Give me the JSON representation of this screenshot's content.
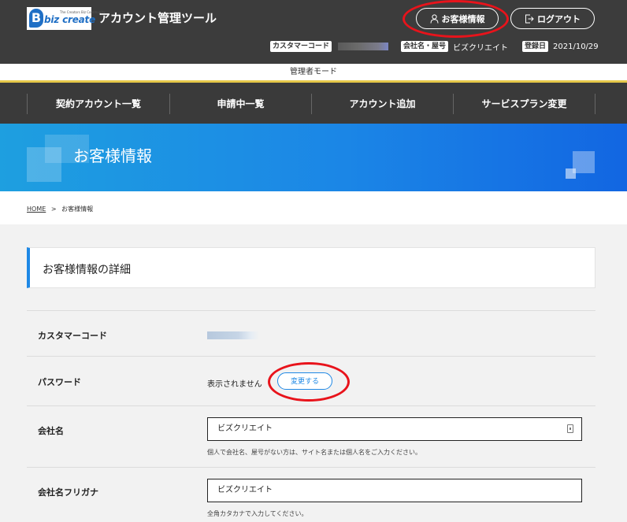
{
  "header": {
    "logo_text": "biz create",
    "logo_sub": "The Creators Biz Community",
    "logo_letter": "B",
    "app_title": "アカウント管理ツール",
    "customer_info_button": "お客様情報",
    "logout_button": "ログアウト",
    "customer_code_label": "カスタマーコード",
    "company_label": "会社名・屋号",
    "company_value": "ビズクリエイト",
    "registered_label": "登録日",
    "registered_value": "2021/10/29"
  },
  "admin_mode": "管理者モード",
  "nav": {
    "items": [
      {
        "label": "契約アカウント一覧"
      },
      {
        "label": "申請中一覧"
      },
      {
        "label": "アカウント追加"
      },
      {
        "label": "サービスプラン変更"
      }
    ]
  },
  "banner": {
    "title": "お客様情報"
  },
  "breadcrumb": {
    "home": "HOME",
    "separator": ">",
    "current": "お客様情報"
  },
  "section": {
    "title": "お客様情報の詳細"
  },
  "rows": {
    "customer_code": {
      "label": "カスタマーコード"
    },
    "password": {
      "label": "パスワード",
      "value": "表示されません",
      "change_button": "変更する"
    },
    "company_name": {
      "label": "会社名",
      "value": "ビズクリエイト",
      "hint": "個人で会社名、屋号がない方は、サイト名または個人名をご入力ください。"
    },
    "company_kana": {
      "label": "会社名フリガナ",
      "value": "ビズクリエイト",
      "hint": "全角カタカナで入力してください。"
    }
  },
  "colors": {
    "accent": "#1e88e5",
    "header_bg": "#3c3c3c",
    "annotation_ring": "#e8131b"
  }
}
